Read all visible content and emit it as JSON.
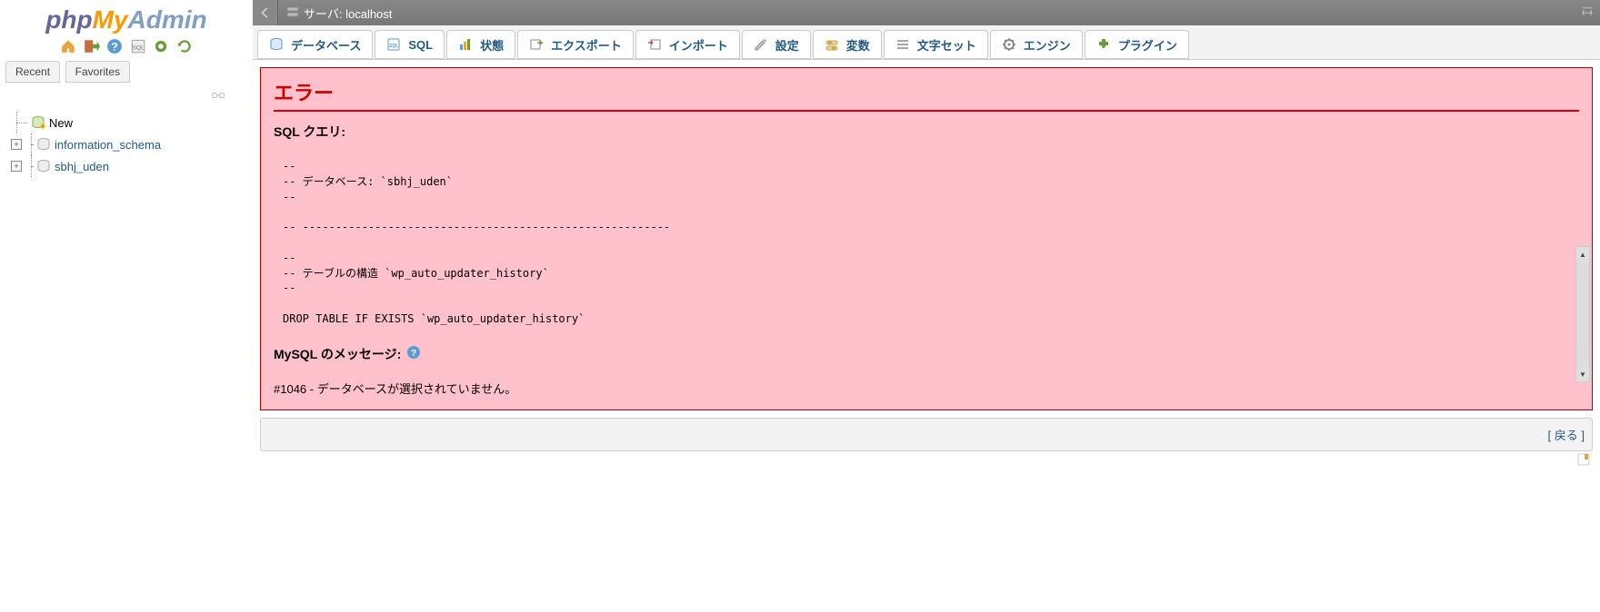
{
  "logo": {
    "php": "php",
    "my": "My",
    "admin": "Admin"
  },
  "sidebar_tabs": {
    "recent": "Recent",
    "favorites": "Favorites"
  },
  "tree": {
    "new": "New",
    "db1": "information_schema",
    "db2": "sbhj_uden"
  },
  "breadcrumb": {
    "label": "サーバ: localhost"
  },
  "tabs": {
    "database": "データベース",
    "sql": "SQL",
    "status": "状態",
    "export": "エクスポート",
    "import": "インポート",
    "settings": "設定",
    "variables": "変数",
    "charset": "文字セット",
    "engine": "エンジン",
    "plugin": "プラグイン"
  },
  "error": {
    "title": "エラー",
    "sql_label": "SQL クエリ:",
    "sql": "--\n-- データベース: `sbhj_uden`\n--\n\n-- --------------------------------------------------------\n\n--\n-- テーブルの構造 `wp_auto_updater_history`\n--\n\nDROP TABLE IF EXISTS `wp_auto_updater_history`",
    "mysql_label": "MySQL のメッセージ:",
    "message": "#1046 - データベースが選択されていません。"
  },
  "backlink": {
    "bracket_open": "[",
    "label": " 戻る ",
    "bracket_close": "]"
  }
}
